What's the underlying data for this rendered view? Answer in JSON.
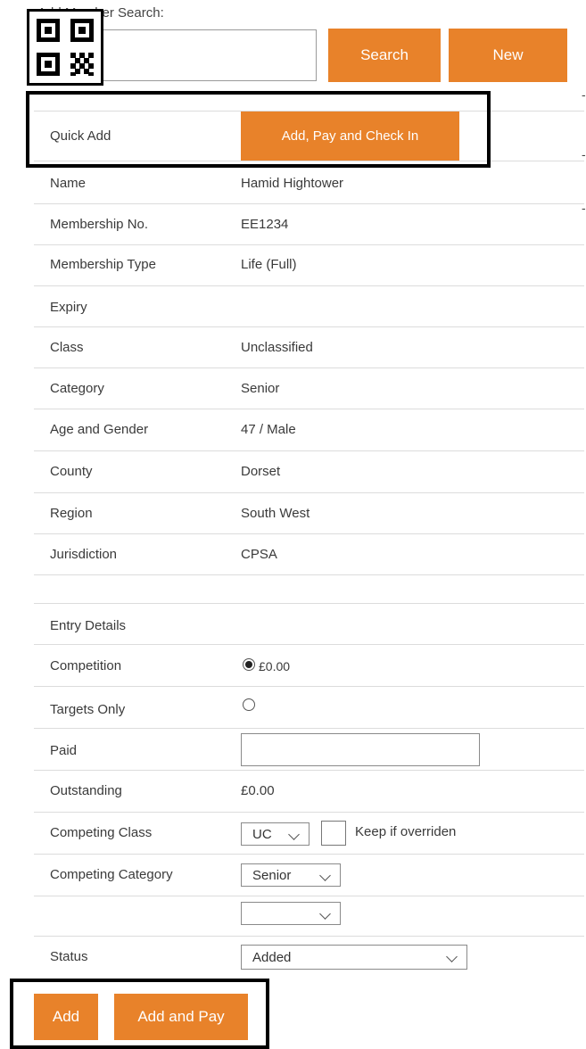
{
  "search": {
    "label": "Add Member Search:",
    "input_value": "",
    "search_button": "Search",
    "new_button": "New"
  },
  "quick_add": {
    "label": "Quick Add",
    "button": "Add, Pay and Check In"
  },
  "member_rows": [
    {
      "label": "Name",
      "value": "Hamid Hightower"
    },
    {
      "label": "Membership No.",
      "value": "EE1234"
    },
    {
      "label": "Membership Type",
      "value": "Life (Full)"
    },
    {
      "label": "Expiry",
      "value": ""
    },
    {
      "label": "Class",
      "value": "Unclassified"
    },
    {
      "label": "Category",
      "value": "Senior"
    },
    {
      "label": "Age and Gender",
      "value": "47 / Male"
    },
    {
      "label": "County",
      "value": "Dorset"
    },
    {
      "label": "Region",
      "value": "South West"
    },
    {
      "label": "Jurisdiction",
      "value": "CPSA"
    }
  ],
  "entry": {
    "header": "Entry Details",
    "competition_label": "Competition",
    "competition_value": "£0.00",
    "competition_selected": true,
    "targets_only_label": "Targets Only",
    "targets_only_selected": false,
    "paid_label": "Paid",
    "paid_value": "",
    "outstanding_label": "Outstanding",
    "outstanding_value": "£0.00",
    "competing_class_label": "Competing Class",
    "competing_class_value": "UC",
    "keep_label": "Keep if overriden",
    "keep_checked": false,
    "competing_category_label": "Competing Category",
    "competing_category_value": "Senior",
    "extra_select_value": "",
    "status_label": "Status",
    "status_value": "Added"
  },
  "actions": {
    "add": "Add",
    "add_and_pay": "Add and Pay"
  },
  "icons": {
    "qr": "qr-code-icon",
    "dropdown": "chevron-down-icon"
  },
  "colors": {
    "accent": "#e8822a",
    "border": "#dcdcdc"
  }
}
